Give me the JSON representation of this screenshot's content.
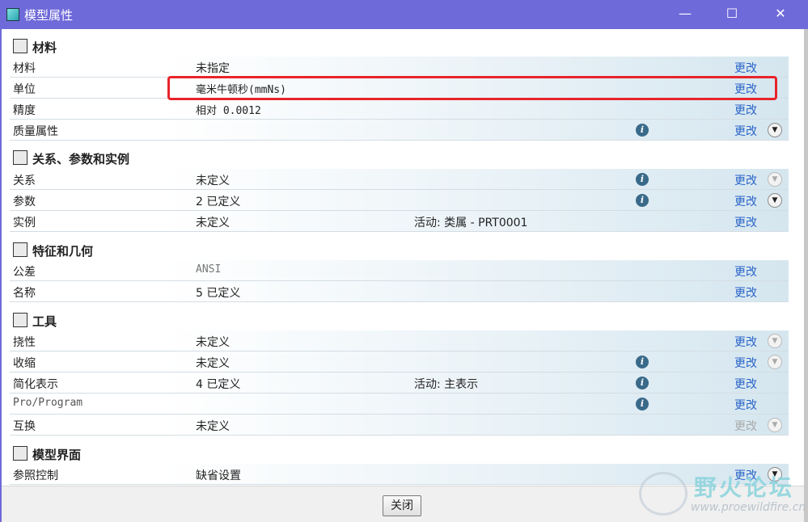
{
  "window": {
    "title": "模型属性",
    "minimize": "—",
    "maximize": "☐",
    "close": "✕"
  },
  "sections": {
    "materials": {
      "title": "材料",
      "rows": [
        {
          "label": "材料",
          "value": "未指定",
          "change": "更改"
        },
        {
          "label": "单位",
          "value": "毫米牛顿秒(mmNs)",
          "change": "更改"
        },
        {
          "label": "精度",
          "value": "相对 0.0012",
          "change": "更改"
        },
        {
          "label": "质量属性",
          "value": "",
          "change": "更改",
          "help": "i",
          "expand": "▼"
        }
      ]
    },
    "relations": {
      "title": "关系、参数和实例",
      "rows": [
        {
          "label": "关系",
          "value": "未定义",
          "change": "更改",
          "help": "i",
          "expand": "▼"
        },
        {
          "label": "参数",
          "value": "2 已定义",
          "change": "更改",
          "help": "i",
          "expand": "▼"
        },
        {
          "label": "实例",
          "value": "未定义",
          "extra": "活动: 类属 - PRT0001",
          "change": "更改"
        }
      ]
    },
    "features": {
      "title": "特征和几何",
      "rows": [
        {
          "label": "公差",
          "value": "ANSI",
          "change": "更改"
        },
        {
          "label": "名称",
          "value": "5 已定义",
          "change": "更改"
        }
      ]
    },
    "tools": {
      "title": "工具",
      "rows": [
        {
          "label": "挠性",
          "value": "未定义",
          "change": "更改",
          "expand": "▼"
        },
        {
          "label": "收缩",
          "value": "未定义",
          "change": "更改",
          "help": "i",
          "expand": "▼"
        },
        {
          "label": "简化表示",
          "value": "4 已定义",
          "extra": "活动: 主表示",
          "change": "更改",
          "help": "i"
        },
        {
          "label": "Pro/Program",
          "value": "",
          "change": "更改",
          "help": "i"
        },
        {
          "label": "互换",
          "value": "未定义",
          "change": "更改",
          "expand": "▼"
        }
      ]
    },
    "interfaces": {
      "title": "模型界面",
      "rows": [
        {
          "label": "参照控制",
          "value": "缺省设置",
          "change": "更改",
          "expand": "▼"
        }
      ]
    }
  },
  "footer": {
    "close_label": "关闭"
  },
  "watermark": {
    "title": "野火论坛",
    "url": "www.proewildfire.cn"
  }
}
